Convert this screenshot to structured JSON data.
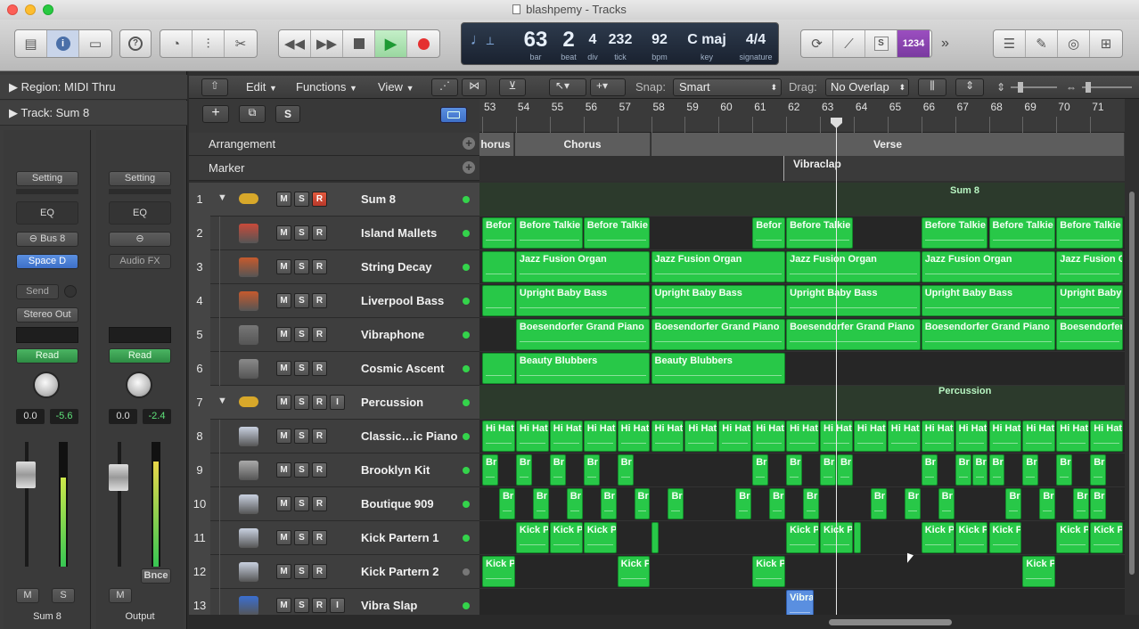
{
  "window": {
    "title": "blashpemy - Tracks"
  },
  "colors": {
    "region": "#28c848",
    "accent": "#3e70c8",
    "led": "#34d34b",
    "record": "#e53030"
  },
  "lcd": {
    "bar": "63",
    "beat": "2",
    "div": "4",
    "tick": "232",
    "bpm": "92",
    "key": "C maj",
    "signature": "4/4",
    "bar_label": "bar",
    "beat_label": "beat",
    "div_label": "div",
    "tick_label": "tick",
    "bpm_label": "bpm",
    "key_label": "key",
    "signature_label": "signature"
  },
  "toolbar": {
    "solo_label": "S",
    "count_label": "1234",
    "more": "»"
  },
  "inspector": {
    "region": "Region: MIDI Thru",
    "track": "Track: Sum 8",
    "strip1": {
      "setting": "Setting",
      "eq": "EQ",
      "bus": "Bus 8",
      "fx": "Space D",
      "send": "Send",
      "output": "Stereo Out",
      "automation": "Read",
      "pan": "0.0",
      "level": "-5.6",
      "mute": "M",
      "solo": "S",
      "name": "Sum 8"
    },
    "strip2": {
      "setting": "Setting",
      "eq": "EQ",
      "fx": "Audio FX",
      "automation": "Read",
      "pan": "0.0",
      "level": "-2.4",
      "mute": "M",
      "bounce": "Bnce",
      "name": "Output"
    }
  },
  "localbar": {
    "edit": "Edit",
    "functions": "Functions",
    "view": "View",
    "snap_label": "Snap:",
    "snap_value": "Smart",
    "drag_label": "Drag:",
    "drag_value": "No Overlap"
  },
  "header": {
    "s": "S"
  },
  "ruler": {
    "bars": [
      "53",
      "54",
      "55",
      "56",
      "57",
      "58",
      "59",
      "60",
      "61",
      "62",
      "63",
      "64",
      "65",
      "66",
      "67",
      "68",
      "69",
      "70",
      "71"
    ]
  },
  "arrangement": {
    "label": "Arrangement",
    "sections": [
      "horus",
      "Chorus",
      "Verse"
    ]
  },
  "marker": {
    "label": "Marker",
    "markers": [
      "Vibraclap"
    ]
  },
  "tracks": [
    {
      "num": "1",
      "name": "Sum 8",
      "stack": true,
      "rec": "R",
      "summary": "Sum 8"
    },
    {
      "num": "2",
      "name": "Island Mallets"
    },
    {
      "num": "3",
      "name": "String Decay"
    },
    {
      "num": "4",
      "name": "Liverpool Bass"
    },
    {
      "num": "5",
      "name": "Vibraphone"
    },
    {
      "num": "6",
      "name": "Cosmic Ascent"
    },
    {
      "num": "7",
      "name": "Percussion",
      "stack": true,
      "summary": "Percussion"
    },
    {
      "num": "8",
      "name": "Classic…ic Piano"
    },
    {
      "num": "9",
      "name": "Brooklyn Kit"
    },
    {
      "num": "10",
      "name": "Boutique 909"
    },
    {
      "num": "11",
      "name": "Kick Partern 1"
    },
    {
      "num": "12",
      "name": "Kick Partern 2"
    },
    {
      "num": "13",
      "name": "Vibra Slap"
    }
  ],
  "button_labels": {
    "m": "M",
    "s": "S",
    "r": "R",
    "i": "I"
  },
  "regions": {
    "2": [
      [
        0,
        1,
        "Befor"
      ],
      [
        1,
        2,
        "Before Talkie"
      ],
      [
        3,
        2,
        "Before Talkie"
      ],
      [
        8,
        1,
        "Befor"
      ],
      [
        9,
        2,
        "Before Talkie"
      ],
      [
        13,
        2,
        "Before Talkie"
      ],
      [
        15,
        2,
        "Before Talkie"
      ],
      [
        17,
        2,
        "Before Talkie"
      ]
    ],
    "3": [
      [
        0,
        1,
        ""
      ],
      [
        1,
        4,
        "Jazz Fusion Organ"
      ],
      [
        5,
        4,
        "Jazz Fusion Organ"
      ],
      [
        9,
        4,
        "Jazz Fusion Organ"
      ],
      [
        13,
        4,
        "Jazz Fusion Organ"
      ],
      [
        17,
        2,
        "Jazz Fusion O"
      ]
    ],
    "4": [
      [
        0,
        1,
        ""
      ],
      [
        1,
        4,
        "Upright Baby Bass"
      ],
      [
        5,
        4,
        "Upright Baby Bass"
      ],
      [
        9,
        4,
        "Upright Baby Bass"
      ],
      [
        13,
        4,
        "Upright Baby Bass"
      ],
      [
        17,
        2,
        "Upright Baby"
      ]
    ],
    "5": [
      [
        1,
        4,
        "Boesendorfer Grand Piano"
      ],
      [
        5,
        4,
        "Boesendorfer Grand Piano"
      ],
      [
        9,
        4,
        "Boesendorfer Grand Piano"
      ],
      [
        13,
        4,
        "Boesendorfer Grand Piano"
      ],
      [
        17,
        2,
        "Boesendorfer"
      ]
    ],
    "6": [
      [
        0,
        1,
        ""
      ],
      [
        1,
        4,
        "Beauty Blubbers"
      ],
      [
        5,
        4,
        "Beauty Blubbers"
      ]
    ],
    "8": [
      [
        0,
        1,
        "Hi Hat"
      ],
      [
        1,
        1,
        "Hi Hat"
      ],
      [
        2,
        1,
        "Hi Hat"
      ],
      [
        3,
        1,
        "Hi Hat"
      ],
      [
        4,
        1,
        "Hi Hat"
      ],
      [
        5,
        1,
        "Hi Hat"
      ],
      [
        6,
        1,
        "Hi Hat"
      ],
      [
        7,
        1,
        "Hi Hat"
      ],
      [
        8,
        1,
        "Hi Hat"
      ],
      [
        9,
        1,
        "Hi Hat"
      ],
      [
        10,
        1,
        "Hi Hat"
      ],
      [
        11,
        1,
        "Hi Hat"
      ],
      [
        12,
        1,
        "Hi Hat"
      ],
      [
        13,
        1,
        "Hi Hat"
      ],
      [
        14,
        1,
        "Hi Hat"
      ],
      [
        15,
        1,
        "Hi Hat"
      ],
      [
        16,
        1,
        "Hi Hat"
      ],
      [
        17,
        1,
        "Hi Hat"
      ],
      [
        18,
        1,
        "Hi Hat"
      ]
    ],
    "9": [
      [
        0,
        0.5,
        "Br"
      ],
      [
        1,
        0.5,
        "Br"
      ],
      [
        2,
        0.5,
        "Br"
      ],
      [
        3,
        0.5,
        "Br"
      ],
      [
        4,
        0.5,
        "Br"
      ],
      [
        8,
        0.5,
        "Br"
      ],
      [
        9,
        0.5,
        "Br"
      ],
      [
        10,
        0.5,
        "Br"
      ],
      [
        10.5,
        0.5,
        "Br"
      ],
      [
        13,
        0.5,
        "Br"
      ],
      [
        14,
        0.5,
        "Br"
      ],
      [
        14.5,
        0.5,
        "Br"
      ],
      [
        15,
        0.5,
        "Br"
      ],
      [
        16,
        0.5,
        "Br"
      ],
      [
        17,
        0.5,
        "Br"
      ],
      [
        18,
        0.5,
        "Br"
      ]
    ],
    "10": [
      [
        0.5,
        0.5,
        "Br"
      ],
      [
        1.5,
        0.5,
        "Br"
      ],
      [
        2.5,
        0.5,
        "Br"
      ],
      [
        3.5,
        0.5,
        "Br"
      ],
      [
        4.5,
        0.5,
        "Br"
      ],
      [
        5.5,
        0.5,
        "Br"
      ],
      [
        7.5,
        0.5,
        "Br"
      ],
      [
        8.5,
        0.5,
        "Br"
      ],
      [
        9.5,
        0.5,
        "Br"
      ],
      [
        11.5,
        0.5,
        "Br"
      ],
      [
        12.5,
        0.5,
        "Br"
      ],
      [
        13.5,
        0.5,
        "Br"
      ],
      [
        15.5,
        0.5,
        "Br"
      ],
      [
        16.5,
        0.5,
        "Br"
      ],
      [
        17.5,
        0.5,
        "Br"
      ],
      [
        18,
        0.5,
        "Br"
      ]
    ],
    "11": [
      [
        1,
        1,
        "Kick P"
      ],
      [
        2,
        1,
        "Kick P"
      ],
      [
        3,
        1,
        "Kick P"
      ],
      [
        5,
        0.2,
        ""
      ],
      [
        9,
        1,
        "Kick P"
      ],
      [
        10,
        1,
        "Kick P"
      ],
      [
        11,
        0.2,
        ""
      ],
      [
        13,
        1,
        "Kick P"
      ],
      [
        14,
        1,
        "Kick P"
      ],
      [
        15,
        1,
        "Kick P"
      ],
      [
        17,
        1,
        "Kick P"
      ],
      [
        18,
        1,
        "Kick P"
      ]
    ],
    "12": [
      [
        0,
        1,
        "Kick P"
      ],
      [
        4,
        1,
        "Kick P"
      ],
      [
        8,
        1,
        "Kick P"
      ],
      [
        16,
        1,
        "Kick P"
      ]
    ],
    "13": [
      [
        9,
        0.85,
        "Vibra"
      ]
    ]
  }
}
